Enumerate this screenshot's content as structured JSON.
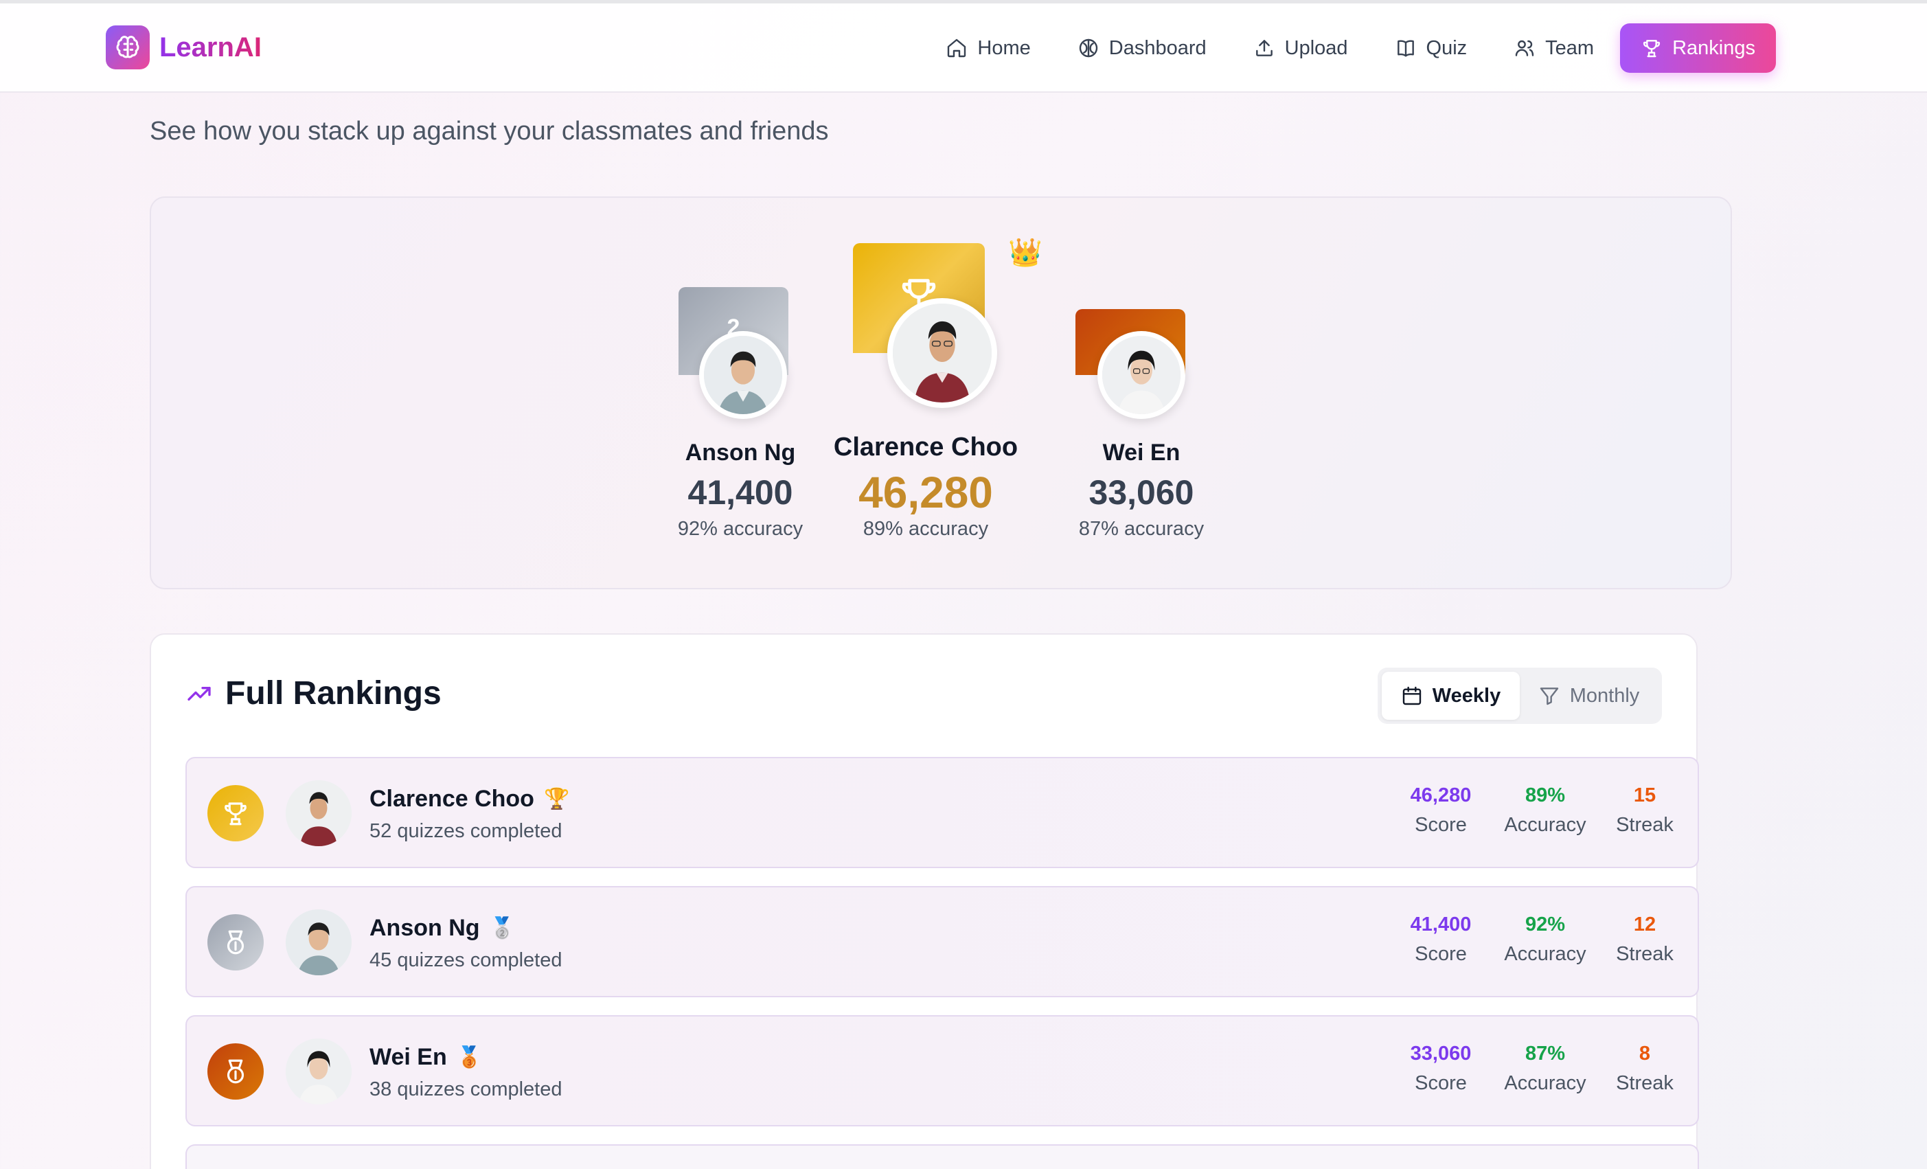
{
  "header": {
    "brand": "LearnAI",
    "nav": [
      {
        "label": "Home",
        "icon": "home-icon",
        "active": false
      },
      {
        "label": "Dashboard",
        "icon": "brain-icon",
        "active": false
      },
      {
        "label": "Upload",
        "icon": "upload-icon",
        "active": false
      },
      {
        "label": "Quiz",
        "icon": "book-icon",
        "active": false
      },
      {
        "label": "Team",
        "icon": "users-icon",
        "active": false
      },
      {
        "label": "Rankings",
        "icon": "trophy-icon",
        "active": true
      }
    ]
  },
  "page": {
    "subtitle": "See how you stack up against your classmates and friends"
  },
  "podium": {
    "first": {
      "name": "Clarence Choo",
      "score": "46,280",
      "accuracy": "89% accuracy",
      "crown": "👑"
    },
    "second": {
      "name": "Anson Ng",
      "score": "41,400",
      "accuracy": "92% accuracy",
      "rank_mark": "2"
    },
    "third": {
      "name": "Wei En",
      "score": "33,060",
      "accuracy": "87% accuracy"
    }
  },
  "rankings": {
    "title": "Full Rankings",
    "toggle": {
      "weekly": "Weekly",
      "monthly": "Monthly",
      "selected": "Weekly"
    },
    "stat_labels": {
      "score": "Score",
      "accuracy": "Accuracy",
      "streak": "Streak"
    },
    "rows": [
      {
        "name": "Clarence Choo",
        "badge": "🏆",
        "sub": "52 quizzes completed",
        "score": "46,280",
        "accuracy": "89%",
        "streak": "15"
      },
      {
        "name": "Anson Ng",
        "badge": "🥈",
        "sub": "45 quizzes completed",
        "score": "41,400",
        "accuracy": "92%",
        "streak": "12"
      },
      {
        "name": "Wei En",
        "badge": "🥉",
        "sub": "38 quizzes completed",
        "score": "33,060",
        "accuracy": "87%",
        "streak": "8"
      }
    ]
  },
  "colors": {
    "accent_purple": "#7c3aed",
    "accent_pink": "#ec4899",
    "gold": "#c58b2a",
    "green": "#16a34a",
    "orange": "#ea580c"
  }
}
